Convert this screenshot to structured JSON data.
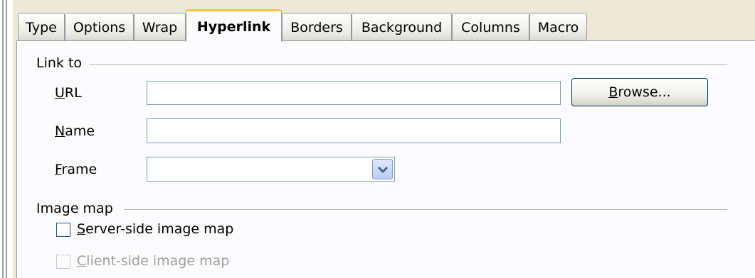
{
  "tabs": [
    {
      "label": "Type",
      "active": false
    },
    {
      "label": "Options",
      "active": false
    },
    {
      "label": "Wrap",
      "active": false
    },
    {
      "label": "Hyperlink",
      "active": true
    },
    {
      "label": "Borders",
      "active": false
    },
    {
      "label": "Background",
      "active": false
    },
    {
      "label": "Columns",
      "active": false
    },
    {
      "label": "Macro",
      "active": false
    }
  ],
  "link_to": {
    "section_title": "Link to",
    "url": {
      "mnemonic": "U",
      "rest": "RL",
      "value": ""
    },
    "name": {
      "mnemonic": "N",
      "rest": "ame",
      "value": ""
    },
    "frame": {
      "mnemonic": "F",
      "rest": "rame",
      "value": ""
    },
    "browse": {
      "mnemonic": "B",
      "rest": "rowse..."
    }
  },
  "image_map": {
    "section_title": "Image map",
    "server_side": {
      "mnemonic": "S",
      "rest": "erver-side image map",
      "checked": false,
      "enabled": true
    },
    "client_side": {
      "mnemonic": "C",
      "rest": "lient-side image map",
      "checked": false,
      "enabled": false
    }
  },
  "icons": {
    "frame_dropdown": "chevron-down-icon"
  },
  "colors": {
    "active_tab_accent": "#ffc83c",
    "dialog_bg": "#ece9d8",
    "panel_bg": "#fcfcfe",
    "field_border": "#7f9db9"
  }
}
